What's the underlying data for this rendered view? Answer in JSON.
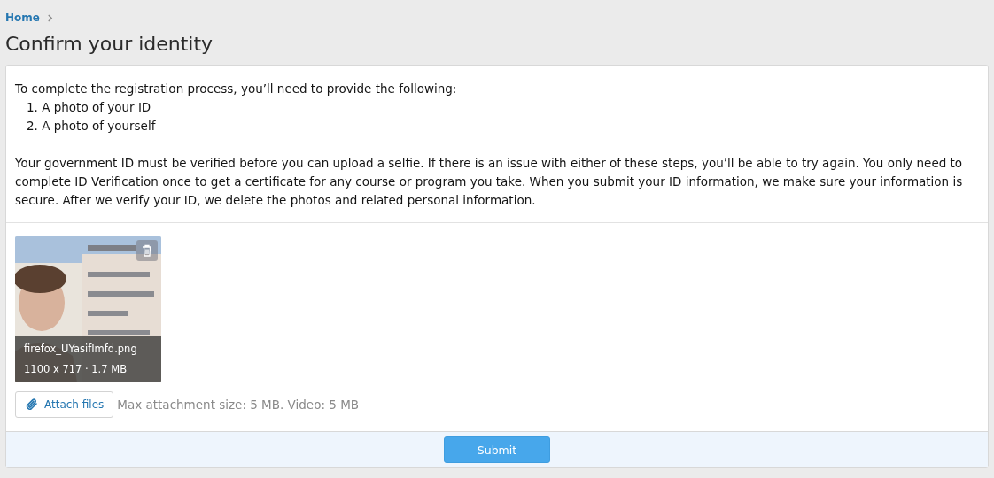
{
  "breadcrumb": {
    "items": [
      {
        "label": "Home"
      }
    ]
  },
  "page_title": "Confirm your identity",
  "intro": {
    "lead": "To complete the registration process, you’ll need to provide the following:",
    "steps": [
      "1. A photo of your ID",
      "2. A photo of yourself"
    ],
    "body": "Your government ID must be verified before you can upload a selfie. If there is an issue with either of these steps, you’ll be able to try again. You only need to complete ID Verification once to get a certificate for any course or program you take. When you submit your ID information, we make sure your information is secure. After we verify your ID, we delete the photos and related personal information."
  },
  "attachments": [
    {
      "kind": "picture",
      "file_name": "firefox_UYasifImfd.png",
      "meta": "1100 x 717 · 1.7 MB"
    }
  ],
  "attach_button": "Attach files",
  "attach_hint": "Max attachment size: 5 MB. Video: 5 MB",
  "submit_button": "Submit"
}
